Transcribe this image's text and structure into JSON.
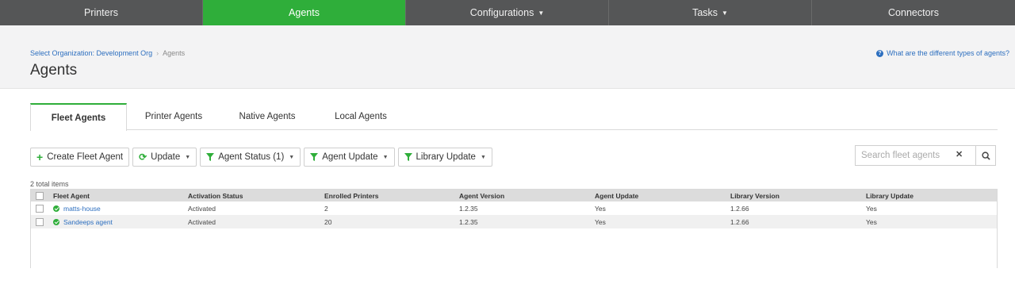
{
  "nav": {
    "items": [
      {
        "label": "Printers",
        "has_caret": false
      },
      {
        "label": "Agents",
        "has_caret": false,
        "active": true
      },
      {
        "label": "Configurations",
        "has_caret": true
      },
      {
        "label": "Tasks",
        "has_caret": true
      },
      {
        "label": "Connectors",
        "has_caret": false
      }
    ],
    "active_color": "#2fae3a",
    "bg_color": "#555657"
  },
  "breadcrumb": {
    "link": "Select Organization: Development Org",
    "current": "Agents"
  },
  "page_title": "Agents",
  "help_link": "What are the different types of agents?",
  "tabs": [
    {
      "label": "Fleet Agents",
      "active": true
    },
    {
      "label": "Printer Agents"
    },
    {
      "label": "Native Agents"
    },
    {
      "label": "Local Agents"
    }
  ],
  "toolbar": {
    "create": "Create Fleet Agent",
    "update": "Update",
    "agent_status": "Agent Status (1)",
    "agent_update": "Agent Update",
    "library_update": "Library Update"
  },
  "search": {
    "placeholder": "Search fleet agents"
  },
  "total_items": "2 total items",
  "table": {
    "columns": [
      "Fleet Agent",
      "Activation Status",
      "Enrolled Printers",
      "Agent Version",
      "Agent Update",
      "Library Version",
      "Library Update"
    ],
    "rows": [
      {
        "name": "matts-house",
        "status": "Activated",
        "printers": "2",
        "agent_version": "1.2.35",
        "agent_update": "Yes",
        "library_version": "1.2.66",
        "library_update": "Yes"
      },
      {
        "name": "Sandeeps agent",
        "status": "Activated",
        "printers": "20",
        "agent_version": "1.2.35",
        "agent_update": "Yes",
        "library_version": "1.2.66",
        "library_update": "Yes"
      }
    ]
  }
}
